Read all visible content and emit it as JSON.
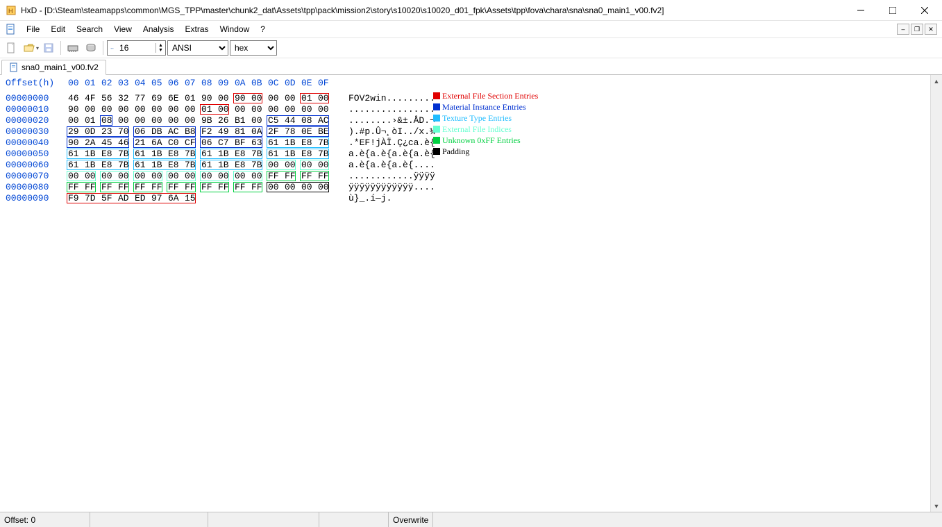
{
  "window": {
    "title": "HxD - [D:\\Steam\\steamapps\\common\\MGS_TPP\\master\\chunk2_dat\\Assets\\tpp\\pack\\mission2\\story\\s10020\\s10020_d01_fpk\\Assets\\tpp\\fova\\chara\\sna\\sna0_main1_v00.fv2]"
  },
  "menu": {
    "file": "File",
    "edit": "Edit",
    "search": "Search",
    "view": "View",
    "analysis": "Analysis",
    "extras": "Extras",
    "window": "Window",
    "help": "?"
  },
  "toolbar": {
    "bytes_per_row": "16",
    "encoding": "ANSI",
    "base": "hex"
  },
  "tab": {
    "label": "sna0_main1_v00.fv2"
  },
  "hex": {
    "header_label": "Offset(h)",
    "cols": [
      "00",
      "01",
      "02",
      "03",
      "04",
      "05",
      "06",
      "07",
      "08",
      "09",
      "0A",
      "0B",
      "0C",
      "0D",
      "0E",
      "0F"
    ],
    "rows": [
      {
        "off": "00000000",
        "b": [
          "46",
          "4F",
          "56",
          "32",
          "77",
          "69",
          "6E",
          "01",
          "90",
          "00",
          "90",
          "00",
          "00",
          "00",
          "01",
          "00"
        ],
        "txt": "FOV2win........."
      },
      {
        "off": "00000010",
        "b": [
          "90",
          "00",
          "00",
          "00",
          "00",
          "00",
          "00",
          "00",
          "01",
          "00",
          "00",
          "00",
          "00",
          "00",
          "00",
          "00"
        ],
        "txt": "................"
      },
      {
        "off": "00000020",
        "b": [
          "00",
          "01",
          "08",
          "00",
          "00",
          "00",
          "00",
          "00",
          "9B",
          "26",
          "B1",
          "00",
          "C5",
          "44",
          "08",
          "AC"
        ],
        "txt": "........›&±.ÅD.¬"
      },
      {
        "off": "00000030",
        "b": [
          "29",
          "0D",
          "23",
          "70",
          "06",
          "DB",
          "AC",
          "B8",
          "F2",
          "49",
          "81",
          "0A",
          "2F",
          "78",
          "0E",
          "BE"
        ],
        "txt": ").#p.Û¬¸òI../x.¾"
      },
      {
        "off": "00000040",
        "b": [
          "90",
          "2A",
          "45",
          "46",
          "21",
          "6A",
          "C0",
          "CF",
          "06",
          "C7",
          "BF",
          "63",
          "61",
          "1B",
          "E8",
          "7B"
        ],
        "txt": ".*EF!jÀÏ.Ç¿ca.è{"
      },
      {
        "off": "00000050",
        "b": [
          "61",
          "1B",
          "E8",
          "7B",
          "61",
          "1B",
          "E8",
          "7B",
          "61",
          "1B",
          "E8",
          "7B",
          "61",
          "1B",
          "E8",
          "7B"
        ],
        "txt": "a.è{a.è{a.è{a.è{"
      },
      {
        "off": "00000060",
        "b": [
          "61",
          "1B",
          "E8",
          "7B",
          "61",
          "1B",
          "E8",
          "7B",
          "61",
          "1B",
          "E8",
          "7B",
          "00",
          "00",
          "00",
          "00"
        ],
        "txt": "a.è{a.è{a.è{...."
      },
      {
        "off": "00000070",
        "b": [
          "00",
          "00",
          "00",
          "00",
          "00",
          "00",
          "00",
          "00",
          "00",
          "00",
          "00",
          "00",
          "FF",
          "FF",
          "FF",
          "FF"
        ],
        "txt": "............ÿÿÿÿ"
      },
      {
        "off": "00000080",
        "b": [
          "FF",
          "FF",
          "FF",
          "FF",
          "FF",
          "FF",
          "FF",
          "FF",
          "FF",
          "FF",
          "FF",
          "FF",
          "00",
          "00",
          "00",
          "00"
        ],
        "txt": "ÿÿÿÿÿÿÿÿÿÿÿÿ...."
      },
      {
        "off": "00000090",
        "b": [
          "F9",
          "7D",
          "5F",
          "AD",
          "ED",
          "97",
          "6A",
          "15"
        ],
        "txt": "ù}_.í—j."
      }
    ],
    "boxes": [
      {
        "row": 0,
        "c": 10,
        "len": 2,
        "color": "#e00000"
      },
      {
        "row": 0,
        "c": 14,
        "len": 2,
        "color": "#e00000"
      },
      {
        "row": 1,
        "c": 8,
        "len": 2,
        "color": "#e00000"
      },
      {
        "row": 2,
        "c": 2,
        "len": 1,
        "color": "#0030d0"
      },
      {
        "row": 2,
        "c": 12,
        "len": 4,
        "color": "#0030d0"
      },
      {
        "row": 3,
        "c": 0,
        "len": 4,
        "color": "#0030d0"
      },
      {
        "row": 3,
        "c": 4,
        "len": 4,
        "color": "#0030d0"
      },
      {
        "row": 3,
        "c": 8,
        "len": 4,
        "color": "#0030d0"
      },
      {
        "row": 3,
        "c": 12,
        "len": 4,
        "color": "#0030d0"
      },
      {
        "row": 4,
        "c": 0,
        "len": 4,
        "color": "#0030d0"
      },
      {
        "row": 4,
        "c": 4,
        "len": 4,
        "color": "#0030d0"
      },
      {
        "row": 4,
        "c": 8,
        "len": 4,
        "color": "#0030d0"
      },
      {
        "row": 4,
        "c": 12,
        "len": 4,
        "color": "#1fbcff"
      },
      {
        "row": 5,
        "c": 0,
        "len": 4,
        "color": "#1fbcff"
      },
      {
        "row": 5,
        "c": 4,
        "len": 4,
        "color": "#1fbcff"
      },
      {
        "row": 5,
        "c": 8,
        "len": 4,
        "color": "#1fbcff"
      },
      {
        "row": 5,
        "c": 12,
        "len": 4,
        "color": "#1fbcff"
      },
      {
        "row": 6,
        "c": 0,
        "len": 4,
        "color": "#1fbcff"
      },
      {
        "row": 6,
        "c": 4,
        "len": 4,
        "color": "#1fbcff"
      },
      {
        "row": 6,
        "c": 8,
        "len": 4,
        "color": "#1fbcff"
      },
      {
        "row": 6,
        "c": 12,
        "len": 2,
        "color": "#66ffd0"
      },
      {
        "row": 6,
        "c": 14,
        "len": 2,
        "color": "#66ffd0"
      },
      {
        "row": 7,
        "c": 0,
        "len": 2,
        "color": "#66ffd0"
      },
      {
        "row": 7,
        "c": 2,
        "len": 2,
        "color": "#66ffd0"
      },
      {
        "row": 7,
        "c": 4,
        "len": 2,
        "color": "#66ffd0"
      },
      {
        "row": 7,
        "c": 6,
        "len": 2,
        "color": "#66ffd0"
      },
      {
        "row": 7,
        "c": 8,
        "len": 2,
        "color": "#66ffd0"
      },
      {
        "row": 7,
        "c": 10,
        "len": 2,
        "color": "#66ffd0"
      },
      {
        "row": 7,
        "c": 12,
        "len": 2,
        "color": "#00d040"
      },
      {
        "row": 7,
        "c": 14,
        "len": 2,
        "color": "#00d040"
      },
      {
        "row": 8,
        "c": 0,
        "len": 2,
        "color": "#00d040"
      },
      {
        "row": 8,
        "c": 2,
        "len": 2,
        "color": "#00d040"
      },
      {
        "row": 8,
        "c": 4,
        "len": 2,
        "color": "#00d040"
      },
      {
        "row": 8,
        "c": 6,
        "len": 2,
        "color": "#00d040"
      },
      {
        "row": 8,
        "c": 8,
        "len": 2,
        "color": "#00d040"
      },
      {
        "row": 8,
        "c": 10,
        "len": 2,
        "color": "#00d040"
      },
      {
        "row": 8,
        "c": 12,
        "len": 4,
        "color": "#000"
      },
      {
        "row": 9,
        "c": 0,
        "len": 8,
        "color": "#e00000"
      }
    ]
  },
  "legend": [
    {
      "color": "#e00000",
      "label": "External File Section Entries"
    },
    {
      "color": "#0030d0",
      "label": "Material Instance Entries"
    },
    {
      "color": "#1fbcff",
      "label": "Texture Type Entries"
    },
    {
      "color": "#66ffd0",
      "label": "External File Indices"
    },
    {
      "color": "#00d040",
      "label": "Unknown 0xFF Entries"
    },
    {
      "color": "#000000",
      "label": "Padding"
    }
  ],
  "status": {
    "offset": "Offset: 0",
    "mode": "Overwrite"
  }
}
